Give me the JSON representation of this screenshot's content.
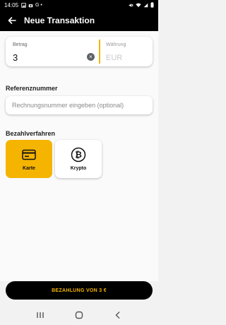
{
  "status_bar": {
    "time": "14:05",
    "notification_glyphs": "G •"
  },
  "app_bar": {
    "title": "Neue Transaktion"
  },
  "amount": {
    "label": "Betrag",
    "value": "3",
    "currency_label": "Währung",
    "currency_value": "EUR"
  },
  "reference": {
    "section_title": "Referenznummer",
    "placeholder": "Rechnungsnummer eingeben (optional)"
  },
  "payment_method": {
    "section_title": "Bezahlverfahren",
    "options": [
      {
        "label": "Karte",
        "icon": "credit-card-icon",
        "selected": true
      },
      {
        "label": "Krypto",
        "icon": "bitcoin-icon",
        "selected": false
      }
    ]
  },
  "pay_button": {
    "label": "BEZAHLUNG VON 3 €"
  },
  "colors": {
    "accent": "#f5b400",
    "bar": "#000000",
    "background": "#fafafa"
  }
}
